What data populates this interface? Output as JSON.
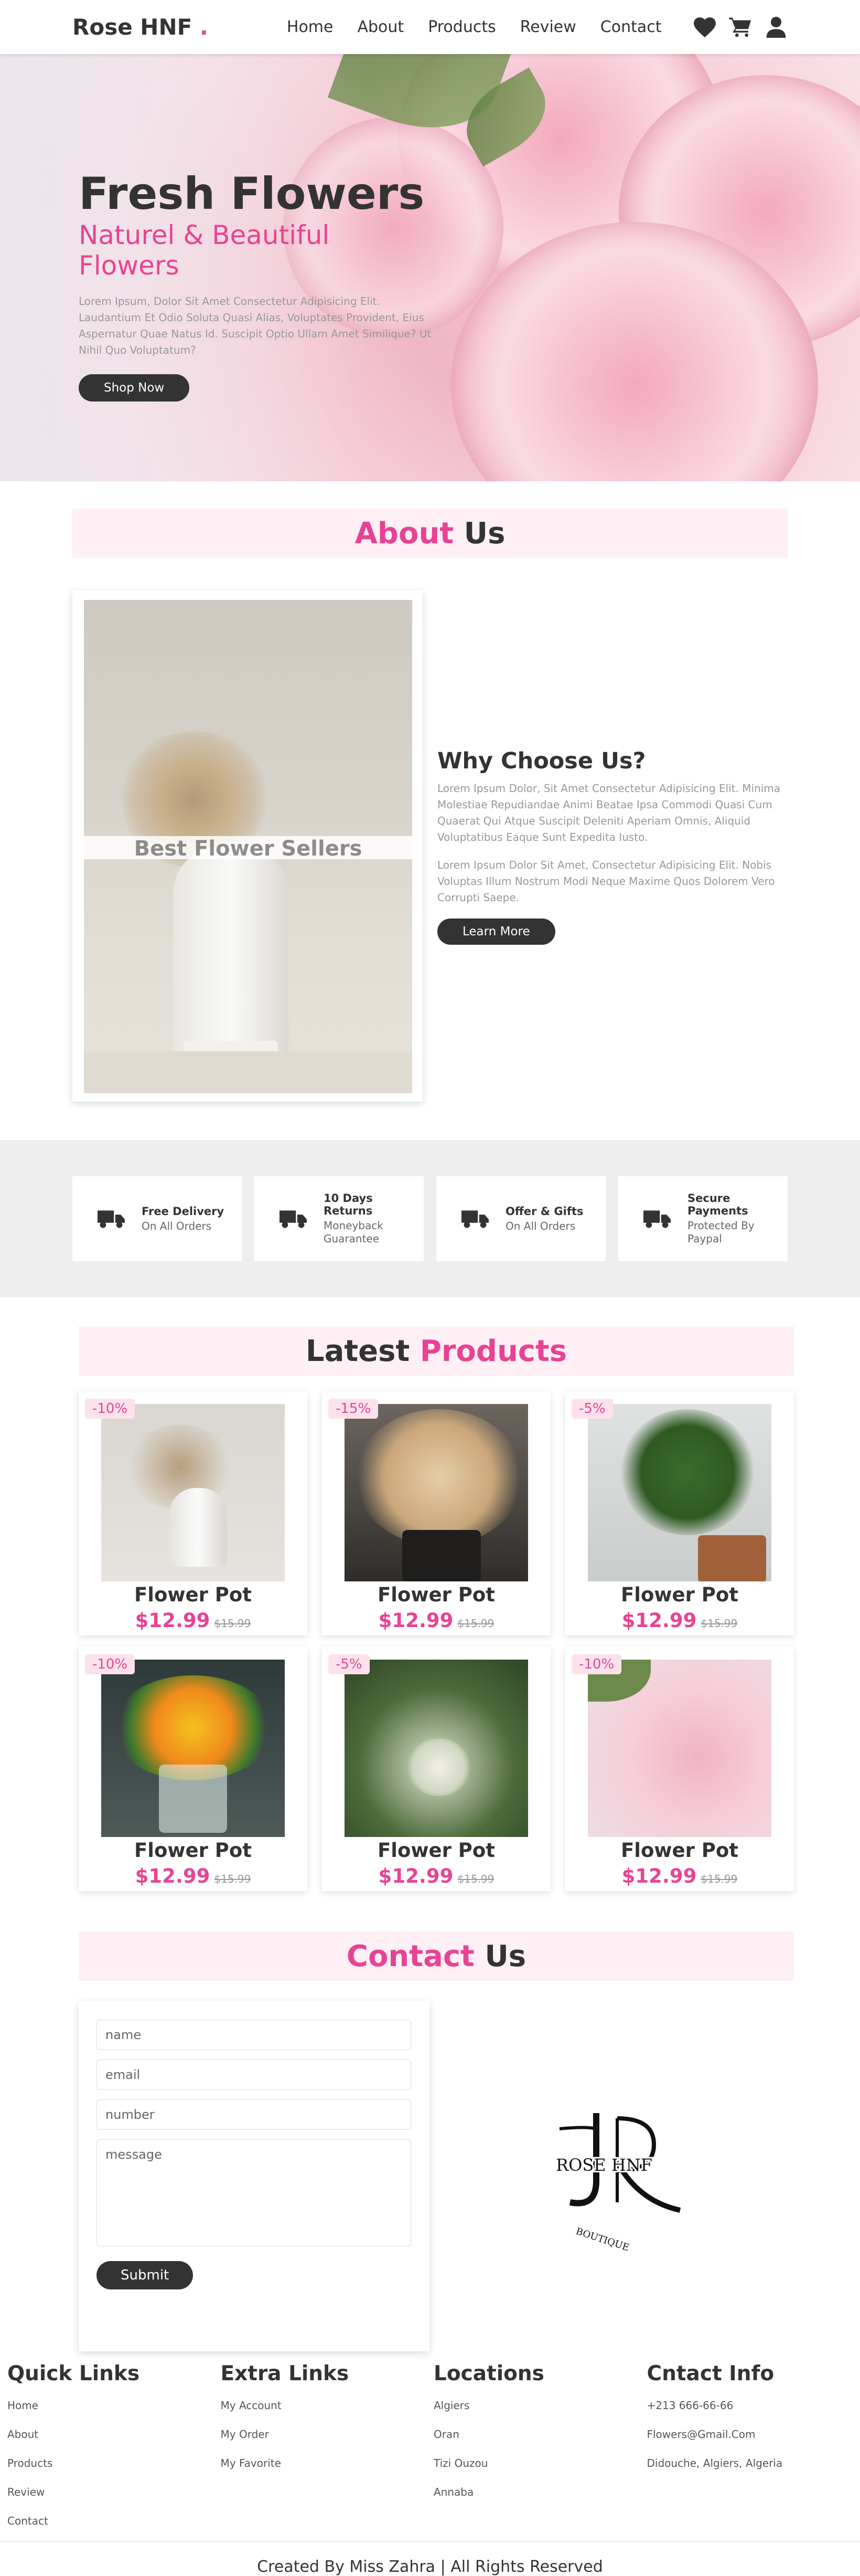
{
  "header": {
    "logo": "Rose HNF",
    "logo_dot": ".",
    "nav": [
      "Home",
      "About",
      "Products",
      "Review",
      "Contact"
    ],
    "icons": [
      "heart-icon",
      "cart-icon",
      "user-icon"
    ]
  },
  "hero": {
    "title": "Fresh Flowers",
    "subtitle": "Naturel & Beautiful Flowers",
    "text": "Lorem Ipsum, Dolor Sit Amet Consectetur Adipisicing Elit. Laudantium Et Odio Soluta Quasi Alias, Voluptates Provident, Eius Aspernatur Quae Natus Id. Suscipit Optio Ullam Amet Similique? Ut Nihil Quo Voluptatum?",
    "button": "Shop Now"
  },
  "about": {
    "heading_pink": "About",
    "heading_dark": " Us",
    "video_label": "Best Flower Sellers",
    "title": "Why Choose Us?",
    "p1": "Lorem Ipsum Dolor, Sit Amet Consectetur Adipisicing Elit. Minima Molestiae Repudiandae Animi Beatae Ipsa Commodi Quasi Cum Quaerat Qui Atque Suscipit Deleniti Aperiam Omnis, Aliquid Voluptatibus Eaque Sunt Expedita Iusto.",
    "p2": "Lorem Ipsum Dolor Sit Amet, Consectetur Adipisicing Elit. Nobis Voluptas Illum Nostrum Modi Neque Maxime Quos Dolorem Vero Corrupti Saepe.",
    "button": "Learn More"
  },
  "features": [
    {
      "title": "Free Delivery",
      "text": "On All Orders"
    },
    {
      "title": "10 Days Returns",
      "text": "Moneyback Guarantee"
    },
    {
      "title": "Offer & Gifts",
      "text": "On All Orders"
    },
    {
      "title": "Secure Payments",
      "text": "Protected By Paypal"
    }
  ],
  "products": {
    "heading_dark": "Latest ",
    "heading_pink": "Products",
    "items": [
      {
        "discount": "-10%",
        "name": "Flower Pot",
        "price": "$12.99",
        "old": "$15.99"
      },
      {
        "discount": "-15%",
        "name": "Flower Pot",
        "price": "$12.99",
        "old": "$15.99"
      },
      {
        "discount": "-5%",
        "name": "Flower Pot",
        "price": "$12.99",
        "old": "$15.99"
      },
      {
        "discount": "-10%",
        "name": "Flower Pot",
        "price": "$12.99",
        "old": "$15.99"
      },
      {
        "discount": "-5%",
        "name": "Flower Pot",
        "price": "$12.99",
        "old": "$15.99"
      },
      {
        "discount": "-10%",
        "name": "Flower Pot",
        "price": "$12.99",
        "old": "$15.99"
      }
    ]
  },
  "contact": {
    "heading_pink": "Contact",
    "heading_dark": " Us",
    "placeholders": {
      "name": "name",
      "email": "email",
      "number": "number",
      "message": "message"
    },
    "submit": "Submit",
    "logo_text": "ROSE HNF",
    "logo_sub": "BOUTIQUE"
  },
  "footer": {
    "columns": [
      {
        "title": "Quick Links",
        "links": [
          "Home",
          "About",
          "Products",
          "Review",
          "Contact"
        ]
      },
      {
        "title": "Extra Links",
        "links": [
          "My Account",
          "My Order",
          "My Favorite"
        ]
      },
      {
        "title": "Locations",
        "links": [
          "Algiers",
          "Oran",
          "Tizi Ouzou",
          "Annaba"
        ]
      },
      {
        "title": "Cntact Info",
        "links": [
          "+213 666-66-66",
          "Flowers@Gmail.Com",
          "Didouche, Algiers, Algeria"
        ]
      }
    ],
    "credit": "Created By Miss Zahra | All Rights Reserved"
  },
  "colors": {
    "accent": "#e84393",
    "dark": "#333333",
    "pink_bg": "#fff0f6",
    "band_bg": "#eeeeee"
  }
}
